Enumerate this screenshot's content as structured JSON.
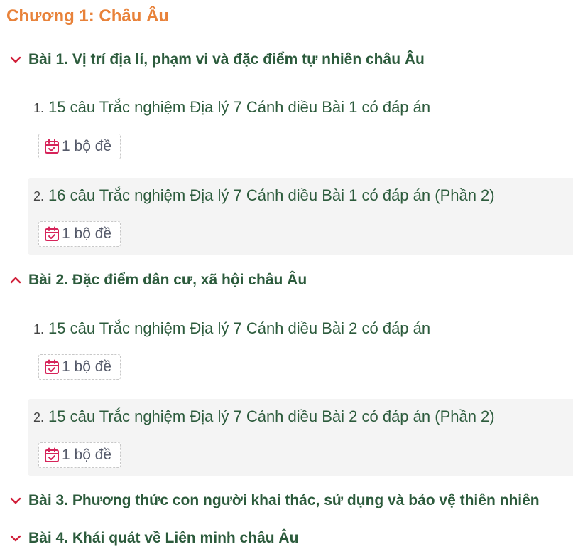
{
  "chapter": {
    "title": "Chương 1: Châu Âu"
  },
  "lessons": [
    {
      "title": "Bài 1. Vị trí địa lí, phạm vi và đặc điểm tự nhiên châu Âu",
      "expanded": true,
      "chevron_icon": "chevron-down-icon",
      "items": [
        {
          "number": "1.",
          "title": "15 câu Trắc nghiệm Địa lý 7 Cánh diều Bài 1 có đáp án",
          "badge": "1 bộ đề"
        },
        {
          "number": "2.",
          "title": "16 câu Trắc nghiệm Địa lý 7 Cánh diều Bài 1 có đáp án (Phần 2)",
          "badge": "1 bộ đề"
        }
      ]
    },
    {
      "title": "Bài 2. Đặc điểm dân cư, xã hội châu Âu",
      "expanded": true,
      "chevron_icon": "chevron-up-icon",
      "items": [
        {
          "number": "1.",
          "title": "15 câu Trắc nghiệm Địa lý 7 Cánh diều Bài 2 có đáp án",
          "badge": "1 bộ đề"
        },
        {
          "number": "2.",
          "title": "15 câu Trắc nghiệm Địa lý 7 Cánh diều Bài 2 có đáp án (Phần 2)",
          "badge": "1 bộ đề"
        }
      ]
    },
    {
      "title": "Bài 3. Phương thức con người khai thác, sử dụng và bảo vệ thiên nhiên",
      "expanded": false,
      "chevron_icon": "chevron-down-icon",
      "items": []
    },
    {
      "title": "Bài 4. Khái quát về Liên minh châu Âu",
      "expanded": false,
      "chevron_icon": "chevron-down-icon",
      "items": []
    }
  ],
  "colors": {
    "chapter_title": "#e8823a",
    "lesson_title": "#2c5b3c",
    "chevron": "#d0203a",
    "calendar_icon": "#d6245a",
    "alt_row_bg": "#f4f4f4"
  }
}
